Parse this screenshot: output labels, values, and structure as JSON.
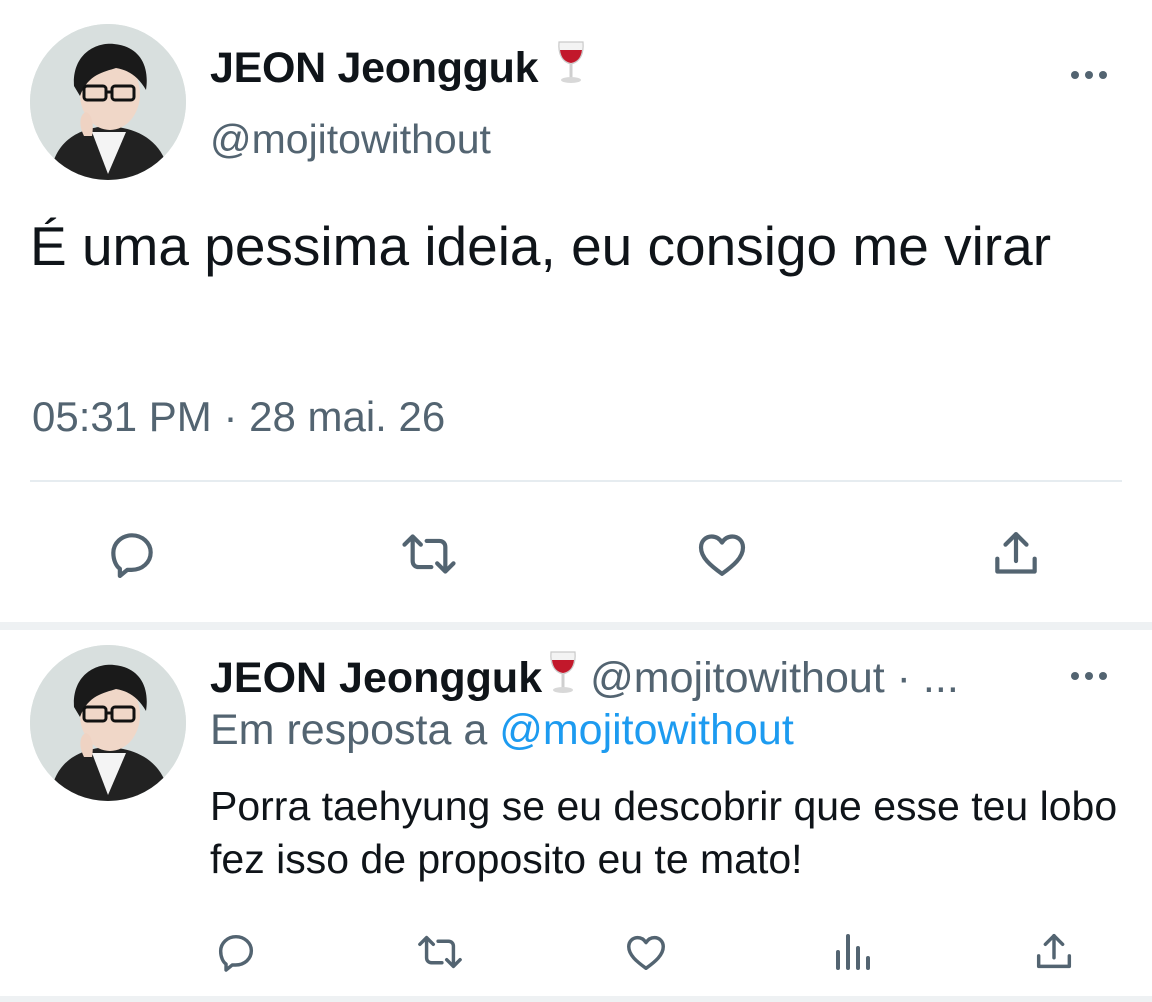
{
  "main_tweet": {
    "author_name": "JEON Jeongguk",
    "name_emoji": "wine-glass-icon",
    "handle": "@mojitowithout",
    "text": "É uma pessima ideia, eu consigo me virar",
    "timestamp": "05:31 PM · 28 mai. 26",
    "actions": [
      "reply-icon",
      "retweet-icon",
      "like-icon",
      "share-icon"
    ]
  },
  "reply_tweet": {
    "author_name": "JEON Jeongguk",
    "name_emoji": "wine-glass-icon",
    "handle": "@mojitowithout · ...",
    "reply_prefix": "Em resposta a ",
    "reply_mention": "@mojitowithout",
    "text": "Porra taehyung se eu descobrir que esse teu lobo fez isso de proposito eu te mato!",
    "actions": [
      "reply-icon",
      "retweet-icon",
      "like-icon",
      "analytics-icon",
      "share-icon"
    ]
  },
  "colors": {
    "text_primary": "#0f1419",
    "text_secondary": "#536471",
    "mention": "#1d9bf0",
    "divider": "#e6ecf0",
    "icon": "#536471"
  }
}
